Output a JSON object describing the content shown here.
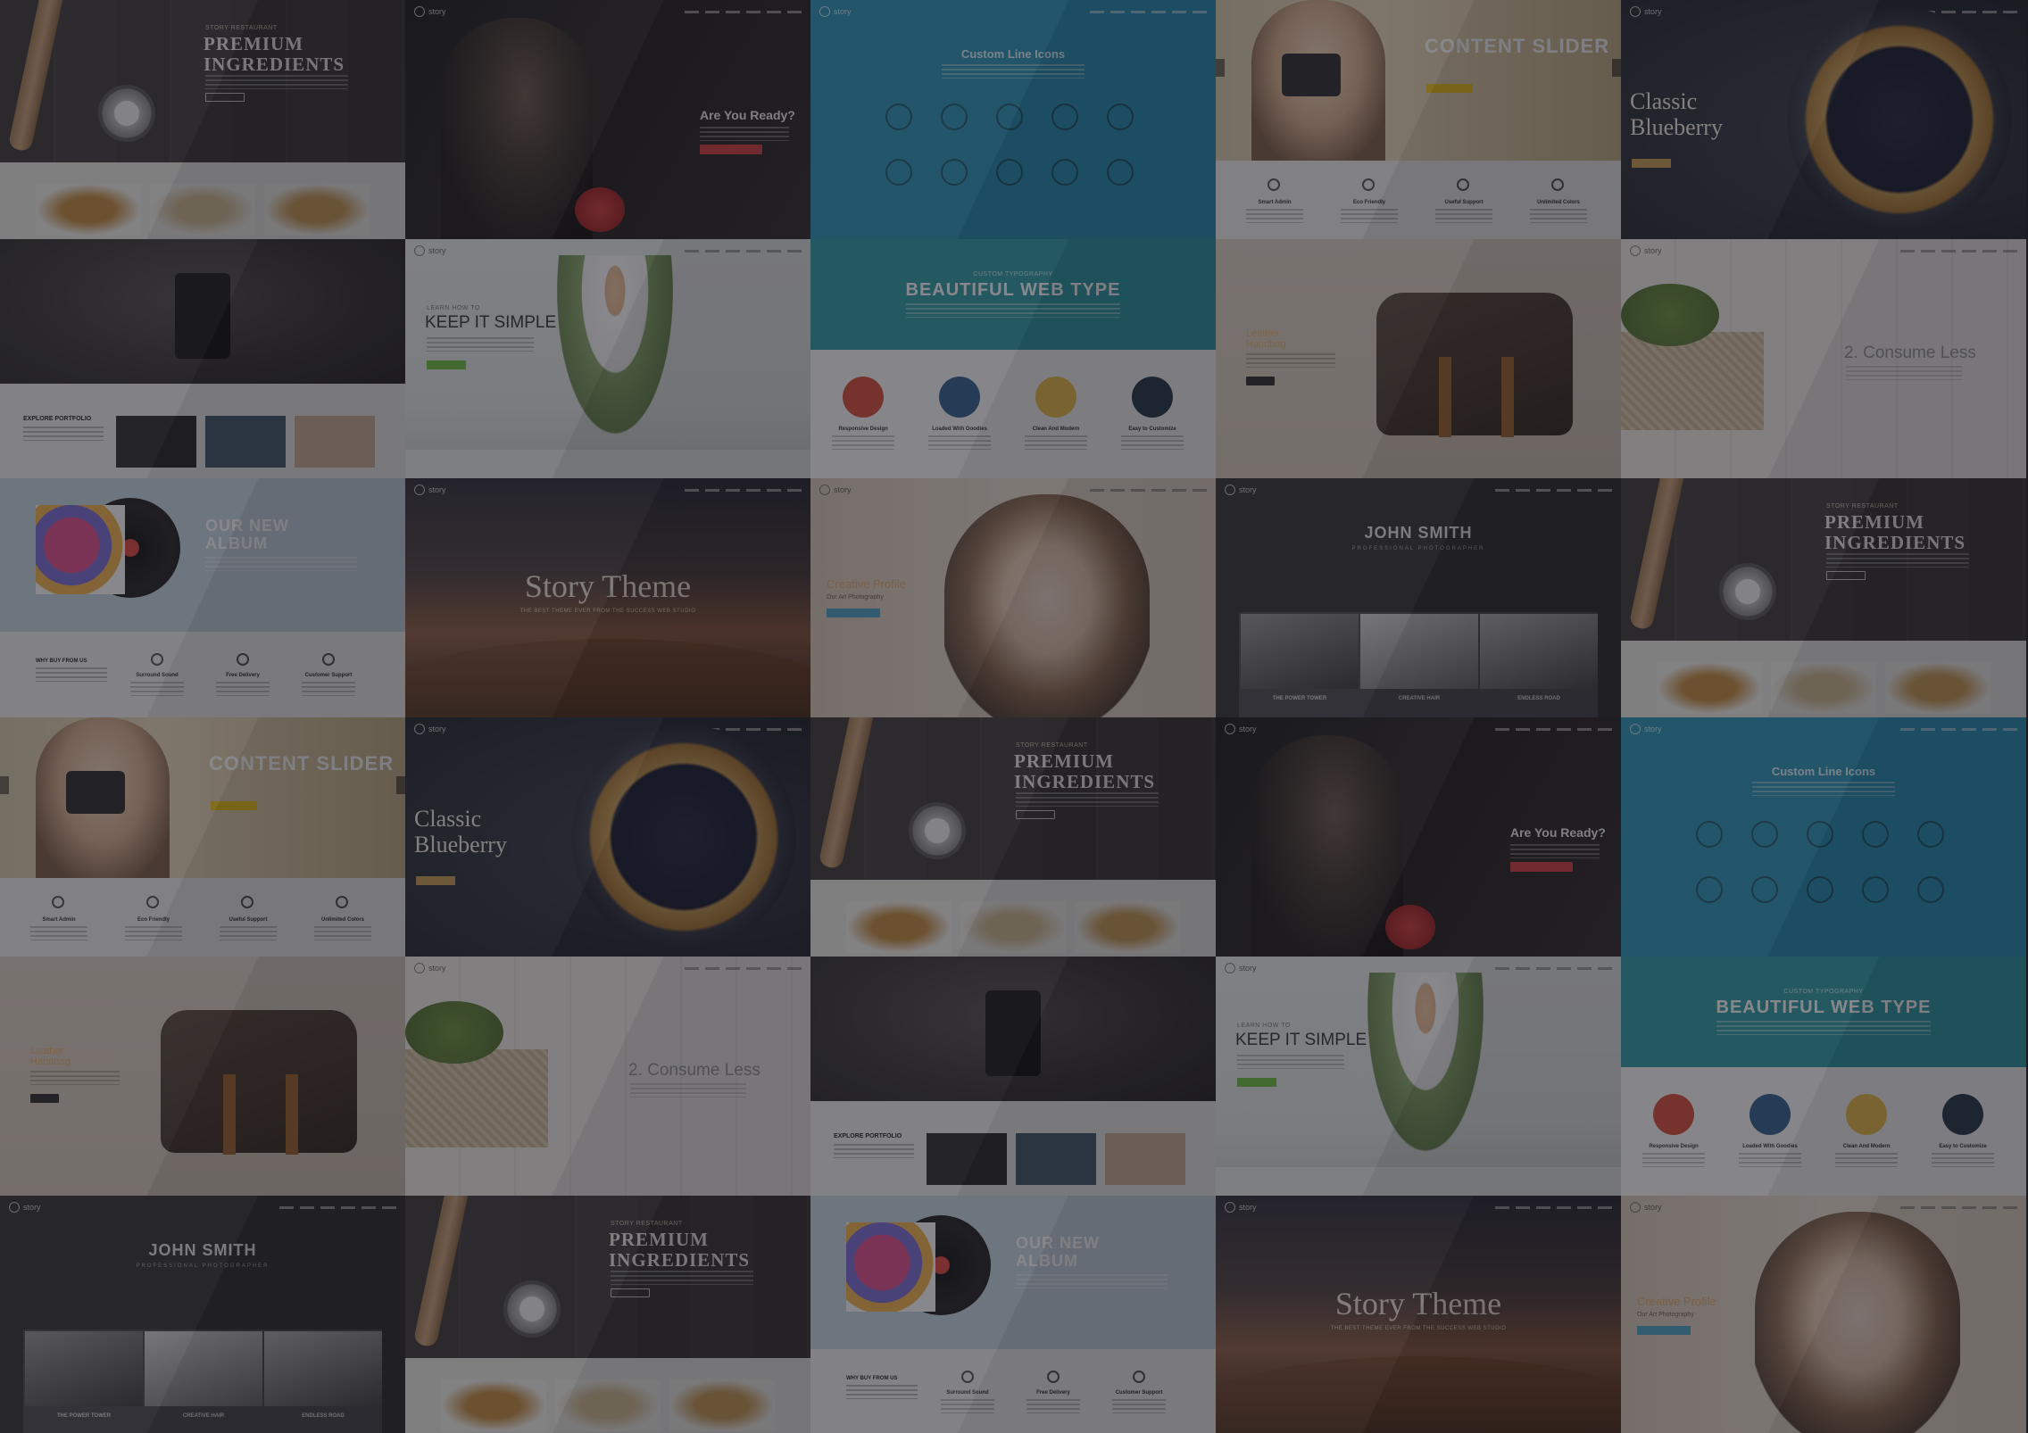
{
  "brand": "story",
  "tiles": [
    {
      "type": "ingredients",
      "col": 0,
      "row": 0,
      "eyebrow": "STORY RESTAURANT",
      "title": "PREMIUM\nINGREDIENTS"
    },
    {
      "type": "ready",
      "col": 1,
      "row": 0,
      "title": "Are You Ready?"
    },
    {
      "type": "icons",
      "col": 2,
      "row": 0,
      "title": "Custom Line Icons"
    },
    {
      "type": "slider",
      "col": 3,
      "row": 0,
      "title": "CONTENT SLIDER",
      "features": [
        "Smart Admin",
        "Eco Friendly",
        "Useful Support",
        "Unlimited Colors"
      ]
    },
    {
      "type": "blueberry",
      "col": 4,
      "row": 0,
      "title": "Classic\nBlueberry"
    },
    {
      "type": "portfolio",
      "col": 0,
      "row": 1,
      "title": "EXPLORE PORTFOLIO"
    },
    {
      "type": "simple",
      "col": 1,
      "row": 1,
      "title": "KEEP IT SIMPLE"
    },
    {
      "type": "webtype",
      "col": 2,
      "row": 1,
      "eyebrow": "CUSTOM TYPOGRAPHY",
      "title": "BEAUTIFUL WEB TYPE",
      "features": [
        "Responsive Design",
        "Loaded With Goodies",
        "Clean And Modern",
        "Easy to Customize"
      ]
    },
    {
      "type": "handbag",
      "col": 3,
      "row": 1,
      "title": "Leather\nHandbag"
    },
    {
      "type": "consume",
      "col": 4,
      "row": 1,
      "title": "2. Consume Less"
    },
    {
      "type": "album",
      "col": 0,
      "row": 2,
      "title": "OUR NEW\nALBUM",
      "features": [
        "Surround Sound",
        "Free Delivery",
        "Customer Support"
      ],
      "sub": "WHY BUY FROM US"
    },
    {
      "type": "story",
      "col": 1,
      "row": 2,
      "title": "Story Theme",
      "sub": "THE BEST THEME EVER FROM THE SUCCESS WEB STUDIO"
    },
    {
      "type": "profile",
      "col": 2,
      "row": 2,
      "title": "Creative Profile",
      "sub": "Our Art Photography"
    },
    {
      "type": "smith",
      "col": 3,
      "row": 2,
      "title": "JOHN SMITH",
      "sub": "PROFESSIONAL PHOTOGRAPHER",
      "captions": [
        "THE POWER TOWER",
        "CREATIVE HAIR",
        "ENDLESS ROAD"
      ]
    },
    {
      "type": "ingredients",
      "col": 4,
      "row": 2,
      "eyebrow": "STORY RESTAURANT",
      "title": "PREMIUM\nINGREDIENTS"
    },
    {
      "type": "slider",
      "col": 0,
      "row": 3,
      "title": "CONTENT SLIDER",
      "features": [
        "Smart Admin",
        "Eco Friendly",
        "Useful Support",
        "Unlimited Colors"
      ]
    },
    {
      "type": "blueberry",
      "col": 1,
      "row": 3,
      "title": "Classic\nBlueberry"
    },
    {
      "type": "ingredients",
      "col": 2,
      "row": 3,
      "eyebrow": "STORY RESTAURANT",
      "title": "PREMIUM\nINGREDIENTS"
    },
    {
      "type": "ready",
      "col": 3,
      "row": 3,
      "title": "Are You Ready?"
    },
    {
      "type": "icons",
      "col": 4,
      "row": 3,
      "title": "Custom Line Icons"
    },
    {
      "type": "handbag",
      "col": 0,
      "row": 4,
      "title": "Leather\nHandbag"
    },
    {
      "type": "consume",
      "col": 1,
      "row": 4,
      "title": "2. Consume Less"
    },
    {
      "type": "portfolio",
      "col": 2,
      "row": 4,
      "title": "EXPLORE PORTFOLIO"
    },
    {
      "type": "simple",
      "col": 3,
      "row": 4,
      "title": "KEEP IT SIMPLE"
    },
    {
      "type": "webtype",
      "col": 4,
      "row": 4,
      "eyebrow": "CUSTOM TYPOGRAPHY",
      "title": "BEAUTIFUL WEB TYPE",
      "features": [
        "Responsive Design",
        "Loaded With Goodies",
        "Clean And Modern",
        "Easy to Customize"
      ]
    },
    {
      "type": "smith",
      "col": 0,
      "row": 5,
      "title": "JOHN SMITH",
      "sub": "PROFESSIONAL PHOTOGRAPHER",
      "captions": [
        "THE POWER TOWER",
        "CREATIVE HAIR",
        "ENDLESS ROAD"
      ]
    },
    {
      "type": "ingredients",
      "col": 1,
      "row": 5,
      "eyebrow": "STORY RESTAURANT",
      "title": "PREMIUM\nINGREDIENTS"
    },
    {
      "type": "album",
      "col": 2,
      "row": 5,
      "title": "OUR NEW\nALBUM",
      "features": [
        "Surround Sound",
        "Free Delivery",
        "Customer Support"
      ],
      "sub": "WHY BUY FROM US"
    },
    {
      "type": "story",
      "col": 3,
      "row": 5,
      "title": "Story Theme",
      "sub": "THE BEST THEME EVER FROM THE SUCCESS WEB STUDIO"
    },
    {
      "type": "profile",
      "col": 4,
      "row": 5,
      "title": "Creative Profile",
      "sub": "Our Art Photography"
    }
  ]
}
